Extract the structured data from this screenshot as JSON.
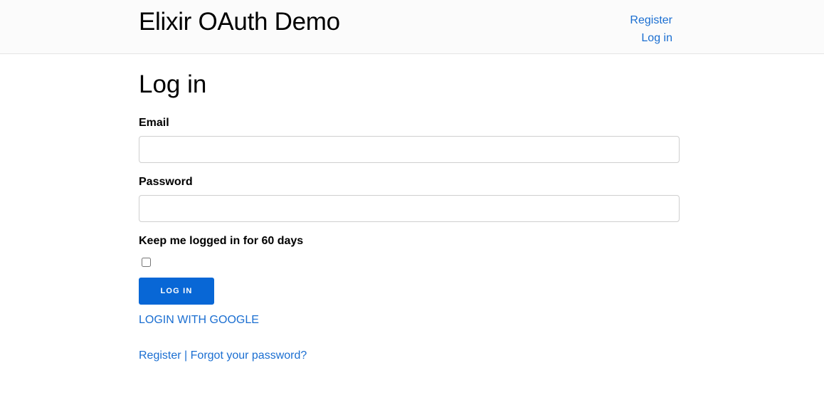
{
  "header": {
    "brand": "Elixir OAuth Demo",
    "nav": {
      "register_label": "Register",
      "login_label": "Log in"
    }
  },
  "main": {
    "title": "Log in",
    "email": {
      "label": "Email",
      "value": "",
      "placeholder": ""
    },
    "password": {
      "label": "Password",
      "value": "",
      "placeholder": ""
    },
    "remember": {
      "label": "Keep me logged in for 60 days",
      "checked": false
    },
    "login_button_label": "LOG IN",
    "google_link_label": "LOGIN WITH GOOGLE",
    "footer_links": {
      "register_label": "Register",
      "separator": "|",
      "forgot_label": "Forgot your password?"
    }
  },
  "colors": {
    "link": "#1a6ed1",
    "button": "#0867d6",
    "header_bg": "#fbfbfb"
  }
}
